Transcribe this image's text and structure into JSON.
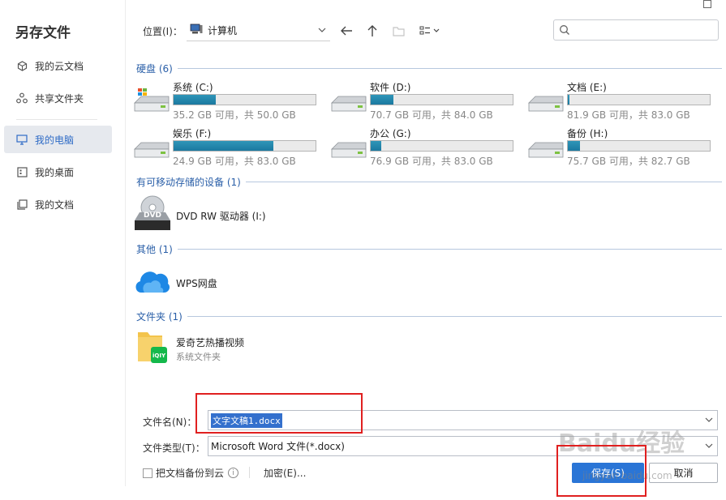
{
  "window": {
    "title": "另存文件"
  },
  "sidebar": {
    "items": [
      {
        "label": "我的云文档",
        "icon": "cloud-doc-icon",
        "active": false
      },
      {
        "label": "共享文件夹",
        "icon": "share-folder-icon",
        "active": false
      },
      {
        "label": "我的电脑",
        "icon": "computer-icon",
        "active": true
      },
      {
        "label": "我的桌面",
        "icon": "desktop-icon",
        "active": false
      },
      {
        "label": "我的文档",
        "icon": "documents-icon",
        "active": false
      }
    ]
  },
  "toolbar": {
    "location_label": "位置(I)：",
    "location_value": "计算机"
  },
  "sections": {
    "drives_header": "硬盘 (6)",
    "removable_header": "有可移动存储的设备 (1)",
    "other_header": "其他 (1)",
    "folders_header": "文件夹 (1)"
  },
  "drives": [
    {
      "name": "系统 (C:)",
      "free": "35.2 GB 可用，共 50.0 GB",
      "used_fraction": 0.296,
      "system": true
    },
    {
      "name": "软件 (D:)",
      "free": "70.7 GB 可用，共 84.0 GB",
      "used_fraction": 0.158,
      "system": false
    },
    {
      "name": "文档 (E:)",
      "free": "81.9 GB 可用，共 83.0 GB",
      "used_fraction": 0.013,
      "system": false
    },
    {
      "name": "娱乐 (F:)",
      "free": "24.9 GB 可用，共 83.0 GB",
      "used_fraction": 0.7,
      "system": false
    },
    {
      "name": "办公 (G:)",
      "free": "76.9 GB 可用，共 83.0 GB",
      "used_fraction": 0.073,
      "system": false
    },
    {
      "name": "备份 (H:)",
      "free": "75.7 GB 可用，共 82.7 GB",
      "used_fraction": 0.085,
      "system": false
    }
  ],
  "removable": {
    "name": "DVD RW 驱动器 (I:)",
    "badge": "DVD"
  },
  "other": {
    "name": "WPS网盘"
  },
  "folder": {
    "name": "爱奇艺热播视频",
    "sub": "系统文件夹",
    "badge": "iQIY"
  },
  "form": {
    "filename_label": "文件名(N)：",
    "filename_value": "文字文稿1.docx",
    "filetype_label": "文件类型(T)：",
    "filetype_value": "Microsoft Word 文件(*.docx)",
    "backup_label": "把文档备份到云",
    "encrypt_label": "加密(E)...",
    "save_label": "保存(S)",
    "cancel_label": "取消"
  },
  "watermark": {
    "text": "Baidu经验",
    "sub": "jingyan.baidu.com"
  },
  "colors": {
    "accent": "#2a75d6",
    "section": "#2a5fa8",
    "disk_fill": "#1b79a0",
    "annotation": "#e02020"
  }
}
